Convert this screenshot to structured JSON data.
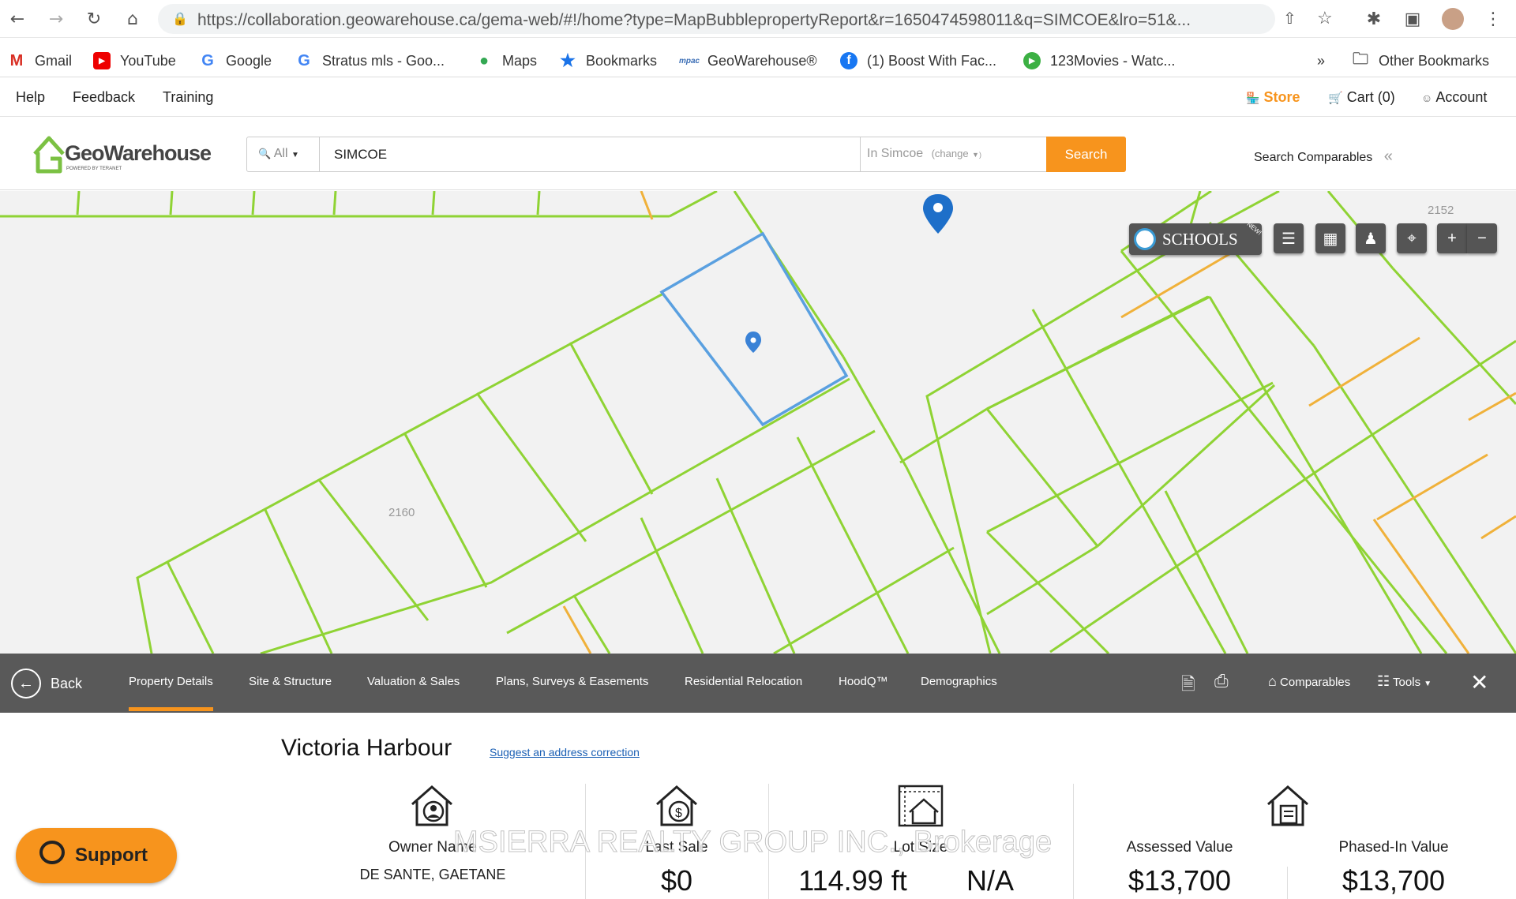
{
  "browser": {
    "url": "https://collaboration.geowarehouse.ca/gema-web/#!/home?type=MapBubblepropertyReport&r=1650474598011&q=SIMCOE&lro=51&...",
    "bookmarks": [
      {
        "label": "Gmail",
        "icon": "gmail-icon"
      },
      {
        "label": "YouTube",
        "icon": "youtube-icon"
      },
      {
        "label": "Google",
        "icon": "google-icon"
      },
      {
        "label": "Stratus mls - Goo...",
        "icon": "google-icon"
      },
      {
        "label": "Maps",
        "icon": "maps-pin-icon"
      },
      {
        "label": "Bookmarks",
        "icon": "star-icon"
      },
      {
        "label": "GeoWarehouse®",
        "icon": "mpac-icon"
      },
      {
        "label": "(1) Boost With Fac...",
        "icon": "facebook-icon"
      },
      {
        "label": "123Movies - Watc...",
        "icon": "play-icon"
      }
    ],
    "overflow_label": "»",
    "other_bookmarks": "Other Bookmarks"
  },
  "sitenav": {
    "help": "Help",
    "feedback": "Feedback",
    "training": "Training",
    "store": "Store",
    "cart": "Cart (0)",
    "account": "Account"
  },
  "header": {
    "logo_main": "GeoWarehouse",
    "logo_sub": "POWERED BY TERANET",
    "search_scope": "All",
    "search_value": "SIMCOE",
    "search_location": "In Simcoe",
    "change_label": "(change",
    "search_button": "Search",
    "search_comparables": "Search Comparables"
  },
  "map": {
    "parcel_labels": [
      "2152",
      "2160"
    ],
    "schools_label": "SCHOOLS",
    "new_badge": "NEW!",
    "colors": {
      "parcel": "#8fd334",
      "orange_line": "#f0b13a",
      "selected": "#5aa0e0",
      "pin": "#1e6fc9"
    }
  },
  "tabbar": {
    "back": "Back",
    "tabs": [
      "Property Details",
      "Site & Structure",
      "Valuation & Sales",
      "Plans, Surveys & Easements",
      "Residential Relocation",
      "HoodQ™",
      "Demographics"
    ],
    "active_tab": "Property Details",
    "comparables": "Comparables",
    "tools": "Tools"
  },
  "property": {
    "title": "Victoria Harbour",
    "suggest_link": "Suggest an address correction",
    "owner_label": "Owner Name",
    "owner_value": "DE SANTE, GAETANE",
    "last_sale_label": "Last Sale",
    "last_sale_value": "$0",
    "lot_size_label": "Lot Size",
    "lot_size_value": "114.99 ft",
    "lot_size_value2": "N/A",
    "assessed_label": "Assessed Value",
    "assessed_value": "$13,700",
    "phased_label": "Phased-In Value",
    "phased_value": "$13,700"
  },
  "watermark": "MSIERRA REALTY GROUP INC., Brokerage",
  "support_label": "Support"
}
